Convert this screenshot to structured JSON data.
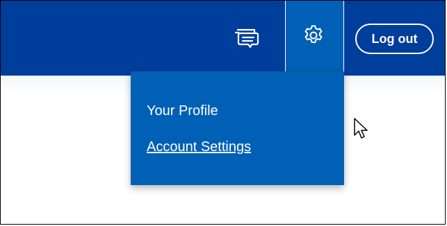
{
  "header": {
    "messages_icon": "chat-bubble-icon",
    "settings_icon": "gear-icon",
    "logout_label": "Log out"
  },
  "settings_menu": {
    "items": [
      {
        "label": "Your Profile"
      },
      {
        "label": "Account Settings"
      }
    ]
  },
  "colors": {
    "header_bg": "#003e9c",
    "menu_bg": "#0060b5",
    "text": "#ffffff"
  }
}
